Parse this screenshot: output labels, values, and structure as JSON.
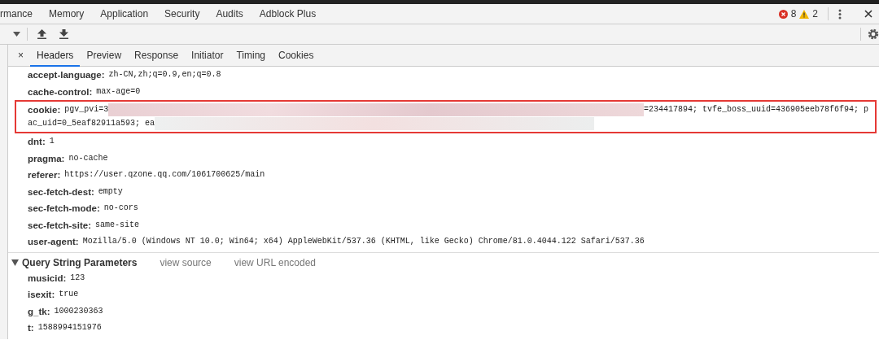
{
  "panel_tabs": [
    {
      "label": "rmance",
      "selected": false
    },
    {
      "label": "Memory",
      "selected": false
    },
    {
      "label": "Application",
      "selected": false
    },
    {
      "label": "Security",
      "selected": false
    },
    {
      "label": "Audits",
      "selected": false
    },
    {
      "label": "Adblock Plus",
      "selected": false
    }
  ],
  "error_count": "8",
  "warning_count": "2",
  "detail_tabs": [
    {
      "label": "Headers",
      "selected": true
    },
    {
      "label": "Preview",
      "selected": false
    },
    {
      "label": "Response",
      "selected": false
    },
    {
      "label": "Initiator",
      "selected": false
    },
    {
      "label": "Timing",
      "selected": false
    },
    {
      "label": "Cookies",
      "selected": false
    }
  ],
  "close_glyph": "×",
  "headers": [
    {
      "kind": "plain",
      "name": "accept-language:",
      "value": "zh-CN,zh;q=0.9,en;q=0.8"
    },
    {
      "kind": "plain",
      "name": "cache-control:",
      "value": "max-age=0"
    },
    {
      "kind": "redacted",
      "name": "cookie:",
      "highlighted": true,
      "lines": [
        {
          "before": "pgv_pvi=3",
          "after": "=234417894; tvfe_boss_uuid=436905eeb78f6f94; p"
        },
        {
          "before": "ac_uid=0_5eaf82911a593; ea"
        }
      ]
    },
    {
      "kind": "plain",
      "name": "dnt:",
      "value": "1"
    },
    {
      "kind": "plain",
      "name": "pragma:",
      "value": "no-cache"
    },
    {
      "kind": "plain",
      "name": "referer:",
      "value": "https://user.qzone.qq.com/1061700625/main"
    },
    {
      "kind": "plain",
      "name": "sec-fetch-dest:",
      "value": "empty"
    },
    {
      "kind": "plain",
      "name": "sec-fetch-mode:",
      "value": "no-cors"
    },
    {
      "kind": "plain",
      "name": "sec-fetch-site:",
      "value": "same-site"
    },
    {
      "kind": "plain",
      "name": "user-agent:",
      "value": "Mozilla/5.0 (Windows NT 10.0; Win64; x64) AppleWebKit/537.36 (KHTML, like Gecko) Chrome/81.0.4044.122 Safari/537.36"
    }
  ],
  "query_section": {
    "title": "Query String Parameters",
    "expanded": true,
    "links": [
      "view source",
      "view URL encoded"
    ],
    "params": [
      {
        "name": "musicid:",
        "value": "123"
      },
      {
        "name": "isexit:",
        "value": "true"
      },
      {
        "name": "g_tk:",
        "value": "1000230363"
      },
      {
        "name": "t:",
        "value": "1588994151976"
      }
    ]
  }
}
